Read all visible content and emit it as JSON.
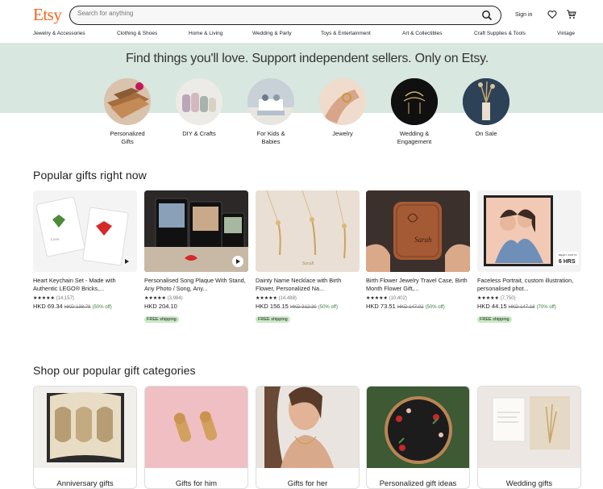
{
  "header": {
    "logo": "Etsy",
    "search_placeholder": "Search for anything",
    "signin": "Sign in"
  },
  "nav": [
    "Jewelry & Accessories",
    "Clothing & Shoes",
    "Home & Living",
    "Wedding & Party",
    "Toys & Entertainment",
    "Art & Collectibles",
    "Craft Supplies & Tools",
    "Vintage"
  ],
  "hero": {
    "tagline": "Find things you'll love. Support independent sellers. Only on Etsy."
  },
  "categories": [
    {
      "label": "Personalized Gifts"
    },
    {
      "label": "DIY & Crafts"
    },
    {
      "label": "For Kids & Babies"
    },
    {
      "label": "Jewelry"
    },
    {
      "label": "Wedding & Engagement"
    },
    {
      "label": "On Sale"
    }
  ],
  "popular": {
    "title": "Popular gifts right now",
    "items": [
      {
        "title": "Heart Keychain Set - Made with Authentic LEGO® Bricks,...",
        "stars": "★★★★★",
        "count": "(14,157)",
        "price": "HKD 69.34",
        "old": "HKD 138.78",
        "off": "(50% off)",
        "shipping": ""
      },
      {
        "title": "Personalised Song Plaque With Stand, Any Photo / Song, Any...",
        "stars": "★★★★★",
        "count": "(3,984)",
        "price": "HKD 204.10",
        "old": "",
        "off": "",
        "shipping": "FREE shipping"
      },
      {
        "title": "Dainty Name Necklace with Birth Flower, Personalized Na...",
        "stars": "★★★★★",
        "count": "(14,488)",
        "price": "HKD 156.15",
        "old": "HKD 312.30",
        "off": "(50% off)",
        "shipping": "FREE shipping"
      },
      {
        "title": "Birth Flower Jewelry Travel Case, Birth Month Flower Gift,...",
        "stars": "★★★★★",
        "count": "(10,402)",
        "price": "HKD 73.51",
        "old": "HKD 147.02",
        "off": "(50% off)",
        "shipping": ""
      },
      {
        "title": "Faceless Portrait, custom illustration, personalised phot...",
        "stars": "★★★★★",
        "count": "(7,750)",
        "price": "HKD 44.15",
        "old": "HKD 147.18",
        "off": "(70% off)",
        "shipping": "FREE shipping"
      }
    ],
    "image_text": {
      "lego_card": "Love",
      "necklace_name": "Sarah",
      "case_name": "Sarah",
      "portrait_badge_top": "READY JUST IN",
      "portrait_badge_main": "6 HRS"
    }
  },
  "gift_categories": {
    "title": "Shop our popular gift categories",
    "items": [
      {
        "label": "Anniversary gifts"
      },
      {
        "label": "Gifts for him"
      },
      {
        "label": "Gifts for her"
      },
      {
        "label": "Personalized gift ideas"
      },
      {
        "label": "Wedding gifts"
      }
    ]
  },
  "colors": {
    "brand": "#f1641e",
    "hero_bg": "#d8e7df",
    "free_ship": "#c9e8c5",
    "sale": "#3b7a3b"
  }
}
